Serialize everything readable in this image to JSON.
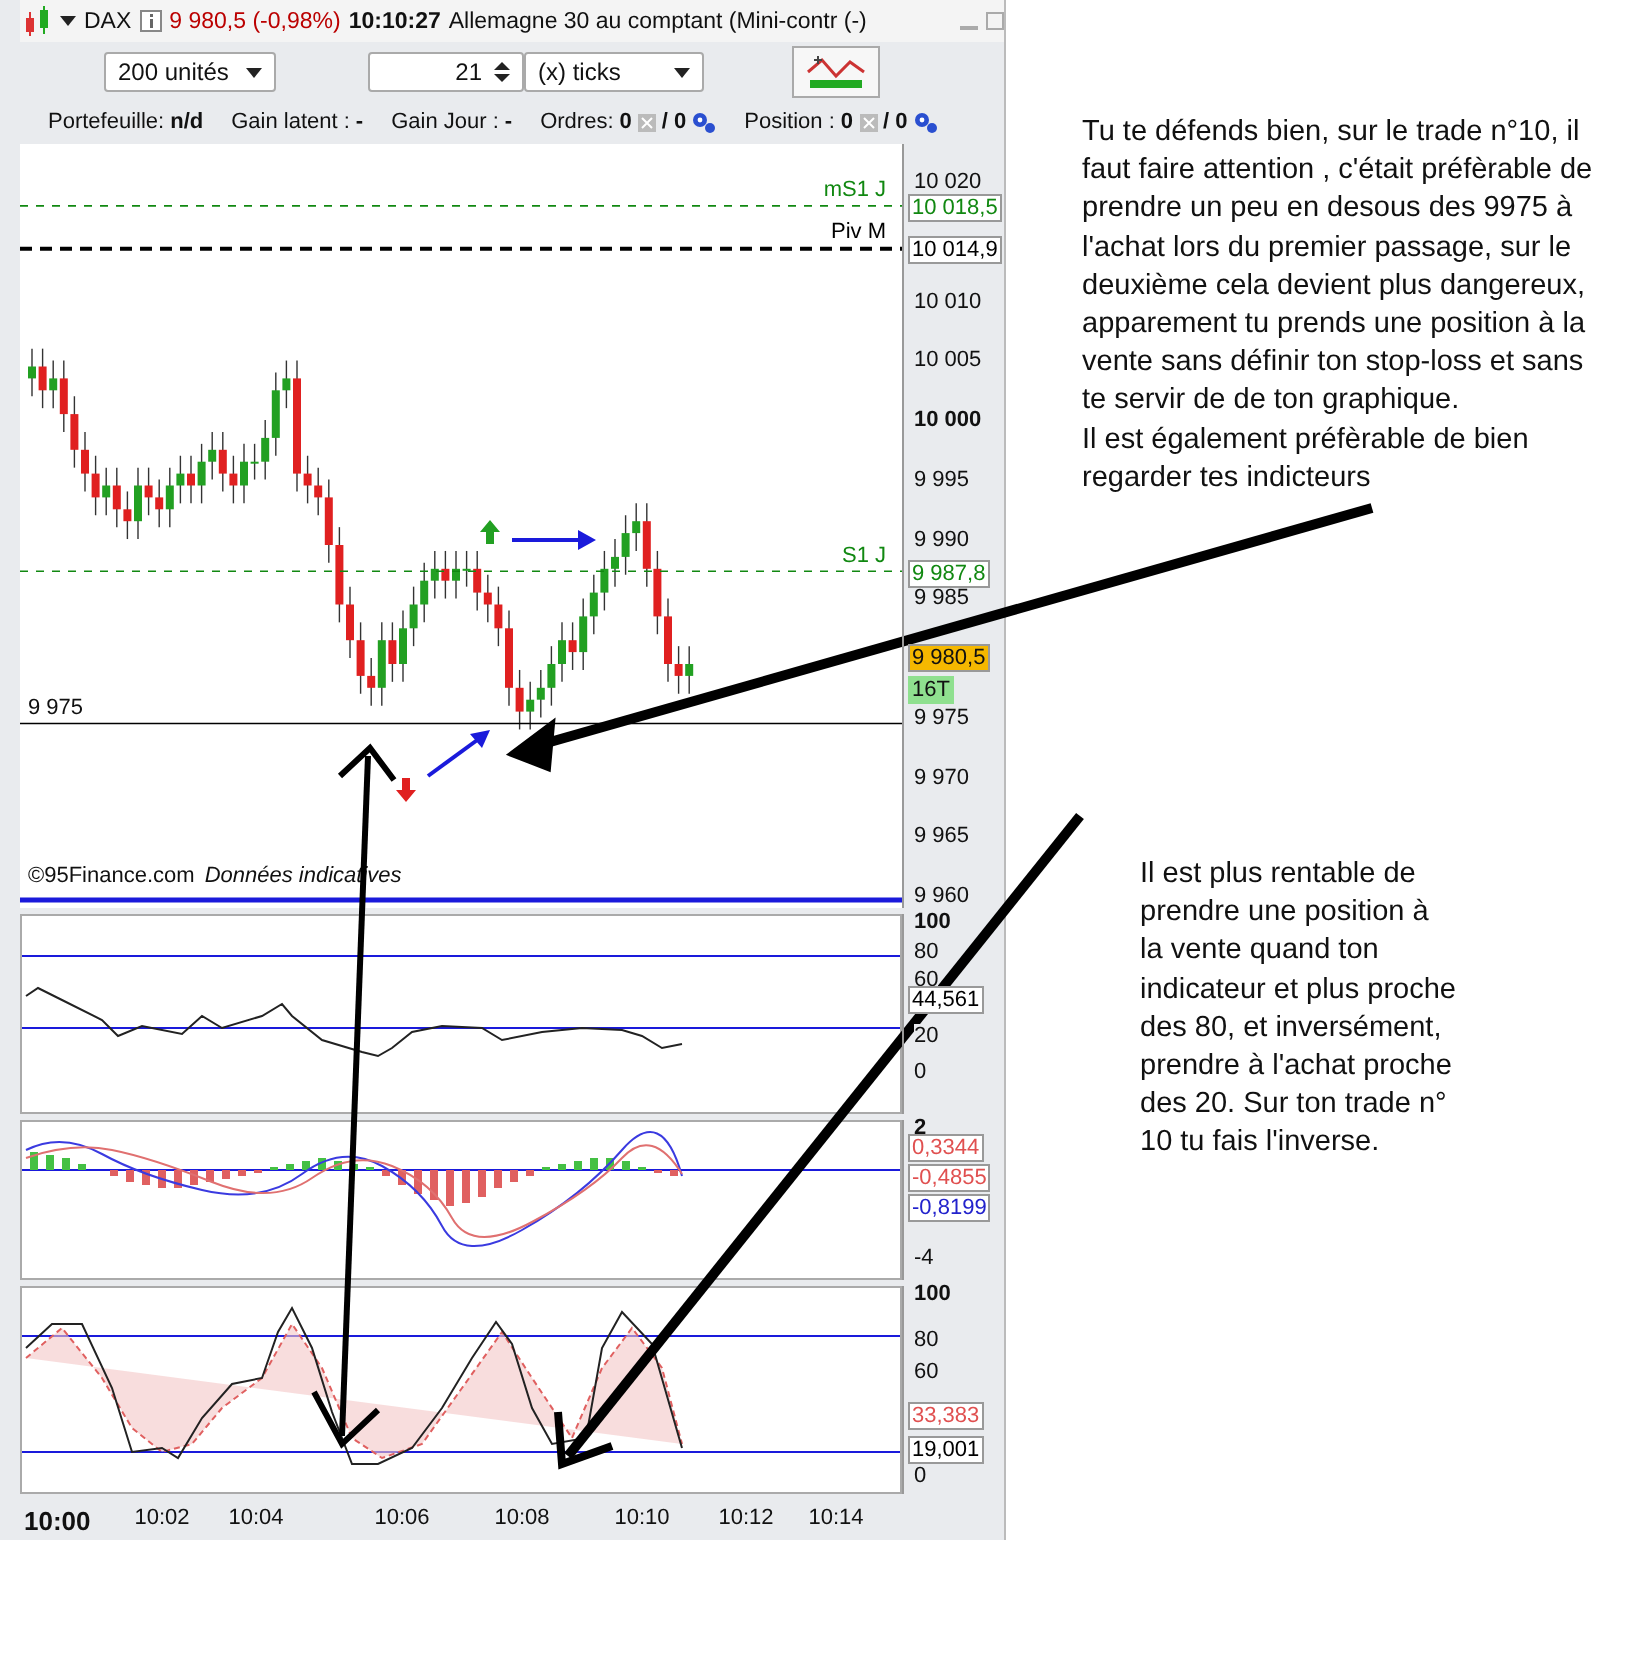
{
  "header": {
    "symbol": "DAX",
    "quote": "9 980,5 (-0,98%)",
    "time": "10:10:27",
    "instrument": "Allemagne 30 au comptant (Mini-contr (-)"
  },
  "order_bar": {
    "quantity": "200 unités",
    "ticks_value": "21",
    "ticks_unit": "(x) ticks"
  },
  "portfolio_bar": [
    {
      "kind": "text",
      "label": "Portefeuille:",
      "value": "n/d"
    },
    {
      "kind": "text",
      "label": "Gain latent :",
      "value": "-"
    },
    {
      "kind": "text",
      "label": "Gain Jour :",
      "value": "-"
    },
    {
      "kind": "counter",
      "label": "Ordres:",
      "value": "0",
      "value2": "/ 0"
    },
    {
      "kind": "counter",
      "label": "Position :",
      "value": "0",
      "value2": "/ 0"
    }
  ],
  "price_chart": {
    "ticks": [
      {
        "label": "10 020",
        "major": false
      },
      {
        "label": "10 010",
        "major": false
      },
      {
        "label": "10 005",
        "major": false
      },
      {
        "label": "10 000",
        "major": true
      },
      {
        "label": "9 995",
        "major": false
      },
      {
        "label": "9 990",
        "major": false
      },
      {
        "label": "9 985",
        "major": false
      },
      {
        "label": "9 975",
        "major": false
      },
      {
        "label": "9 970",
        "major": false
      },
      {
        "label": "9 965",
        "major": false
      },
      {
        "label": "9 960",
        "major": false
      }
    ],
    "levels": [
      {
        "label": "mS1 J",
        "value": "10 018,5",
        "color": "#118811",
        "kind": "thin"
      },
      {
        "label": "Piv M",
        "value": "10 014,9",
        "color": "#000000",
        "kind": "thick"
      },
      {
        "label": "S1 J",
        "value": "9 987,8",
        "color": "#118811",
        "kind": "thin"
      }
    ],
    "support_label": "9 975",
    "last_price": "9 980,5",
    "tick_count": "16T",
    "notice": "©95Finance.com",
    "notice_note": "Données indicatives"
  },
  "indicators": [
    {
      "kind": "rsi",
      "ticks": [
        "100",
        "80",
        "60",
        "20",
        "0"
      ],
      "readings": [
        {
          "value": "44,561",
          "color": "#000000"
        }
      ]
    },
    {
      "kind": "macd",
      "ticks": [
        "2",
        "-4"
      ],
      "readings": [
        {
          "value": "0,3344",
          "color": "#e05050"
        },
        {
          "value": "-0,4855",
          "color": "#e05050"
        },
        {
          "value": "-0,8199",
          "color": "#2222cc"
        }
      ]
    },
    {
      "kind": "stochastic",
      "ticks": [
        "100",
        "80",
        "60",
        "0"
      ],
      "readings": [
        {
          "value": "33,383",
          "color": "#e05050"
        },
        {
          "value": "19,001",
          "color": "#000000"
        }
      ]
    }
  ],
  "time_axis": [
    {
      "label": "10:00",
      "major": true
    },
    {
      "label": "10:02",
      "major": false
    },
    {
      "label": "10:04",
      "major": false
    },
    {
      "label": "10:06",
      "major": false
    },
    {
      "label": "10:08",
      "major": false
    },
    {
      "label": "10:10",
      "major": false
    },
    {
      "label": "10:12",
      "major": false
    },
    {
      "label": "10:14",
      "major": false
    }
  ],
  "notes": [
    {
      "paragraphs": [
        "Tu te défends bien, sur le trade n°10, il faut faire attention , c'était préfèrable de prendre un peu en desous des 9975 à l'achat lors du premier passage, sur le deuxième cela devient plus dangereux, apparement tu prends une position à la vente sans définir ton stop-loss et sans te servir de  de ton graphique.",
        "Il est également préfèrable de bien regarder tes indicteurs"
      ]
    },
    {
      "paragraphs": [
        "Il est plus rentable de prendre une position à la vente quand ton indicateur et plus proche des 80, et inversément, prendre à l'achat proche des 20. Sur ton trade n° 10 tu fais l'inverse."
      ]
    }
  ]
}
